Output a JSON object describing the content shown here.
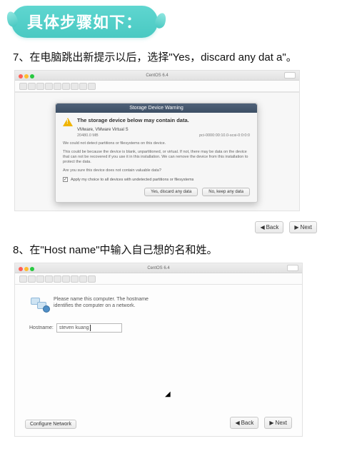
{
  "header": {
    "title": "具体步骤如下："
  },
  "step7": {
    "label": "7、在电脑跳出新提示以后，选择\"Yes，discard any dat a\"。",
    "window_title": "CentOS 6.4",
    "dialog": {
      "title": "Storage Device Warning",
      "heading": "The storage device below may contain data.",
      "device": "VMware, VMware Virtual S",
      "size": "20480.0 MB",
      "bus": "pci-0000:00:10.0-scsi-0:0:0:0",
      "p1": "We could not detect partitions or filesystems on this device.",
      "p2": "This could be because the device is blank, unpartitioned, or virtual. If not, there may be data on the device that can not be recovered if you use it in this installation. We can remove the device from this installation to protect the data.",
      "p3": "Are you sure this device does not contain valuable data?",
      "check": "Apply my choice to all devices with undetected partitions or filesystems",
      "btn_yes": "Yes, discard any data",
      "btn_no": "No, keep any data"
    },
    "nav": {
      "back": "Back",
      "next": "Next"
    }
  },
  "step8": {
    "label": "8、在\"Host name\"中输入自己想的名和姓。",
    "window_title": "CentOS 6.4",
    "intro": "Please name this computer. The hostname identifies the computer on a network.",
    "hostname_label": "Hostname:",
    "hostname_value": "steven kuang",
    "configure": "Configure Network",
    "nav": {
      "back": "Back",
      "next": "Next"
    }
  }
}
